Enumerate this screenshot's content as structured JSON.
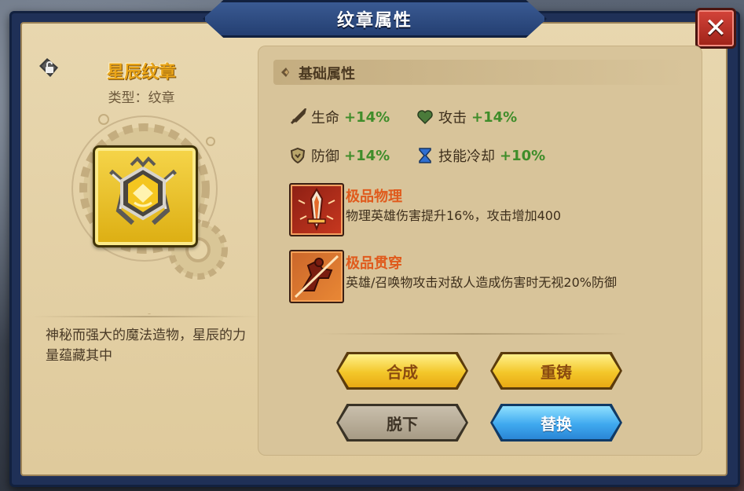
{
  "window": {
    "title": "纹章属性"
  },
  "emblem": {
    "name": "星辰纹章",
    "type_label": "类型：纹章",
    "description": "神秘而强大的魔法造物，星辰的力量蕴藏其中"
  },
  "section": {
    "title": "基础属性"
  },
  "stats": [
    {
      "name": "生命",
      "value": "+14%",
      "icon": "sword-icon"
    },
    {
      "name": "攻击",
      "value": "+14%",
      "icon": "heart-icon"
    },
    {
      "name": "防御",
      "value": "+14%",
      "icon": "shield-icon"
    },
    {
      "name": "技能冷却",
      "value": "+10%",
      "icon": "hourglass-icon"
    }
  ],
  "skills": [
    {
      "title": "极品物理",
      "desc": "物理英雄伤害提升16%，攻击增加400",
      "icon": "sword-burst-icon"
    },
    {
      "title": "极品贯穿",
      "desc": "英雄/召唤物攻击对敌人造成伤害时无视20%防御",
      "icon": "pierce-icon"
    }
  ],
  "buttons": {
    "synthesize": "合成",
    "recast": "重铸",
    "unequip": "脱下",
    "replace": "替换",
    "close": "✕"
  },
  "colors": {
    "stat_value": "#3f8d2a",
    "skill_title": "#e05a1c",
    "emblem_name": "#e9a418"
  }
}
